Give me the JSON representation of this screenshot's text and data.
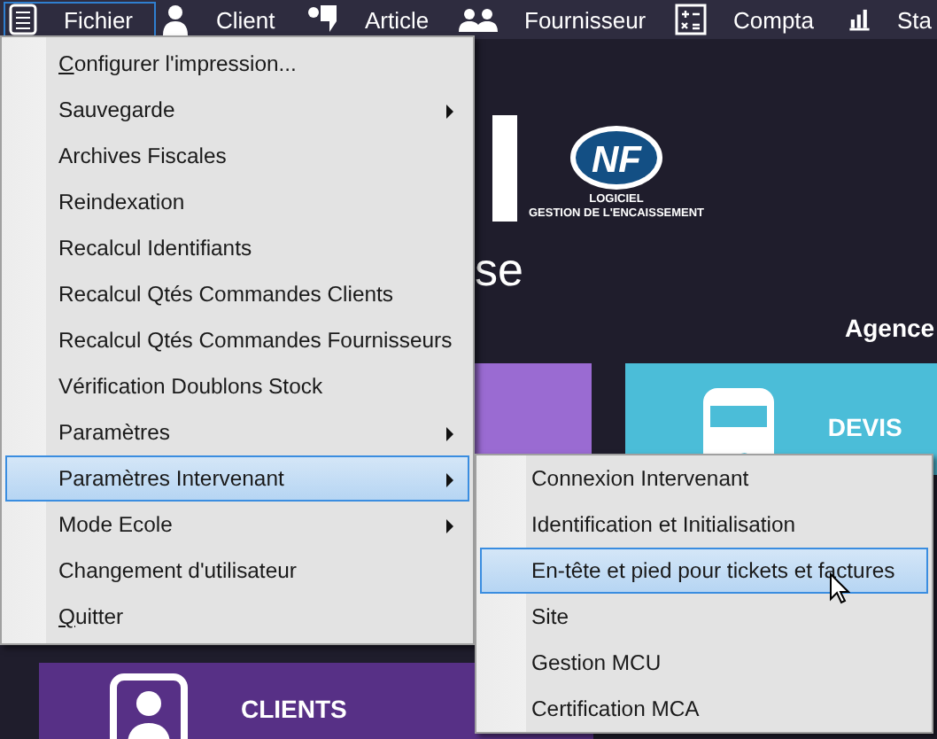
{
  "menubar": {
    "items": [
      {
        "label": "Fichier",
        "selected": true
      },
      {
        "label": "Client",
        "selected": false
      },
      {
        "label": "Article",
        "selected": false
      },
      {
        "label": "Fournisseur",
        "selected": false
      },
      {
        "label": "Compta",
        "selected": false
      },
      {
        "label": "Sta",
        "selected": false
      }
    ]
  },
  "dashboard": {
    "logo": {
      "mark": "NF",
      "caption_1": "LOGICIEL",
      "caption_2": "GESTION DE L'ENCAISSEMENT"
    },
    "title_fragment": "se",
    "agency": "Agence",
    "tiles": [
      {
        "color": "#9a6bd2"
      },
      {
        "label": "DEVIS",
        "color": "#4bbdd8"
      },
      {
        "label": "CLIENTS",
        "color": "#573086"
      }
    ]
  },
  "menu": {
    "items": [
      {
        "label": "Configurer l'impression...",
        "submenu": false,
        "selected": false,
        "mnemonic": true
      },
      {
        "label": "Sauvegarde",
        "submenu": true,
        "selected": false,
        "mnemonic": false
      },
      {
        "label": "Archives Fiscales",
        "submenu": false,
        "selected": false,
        "mnemonic": false
      },
      {
        "label": "Reindexation",
        "submenu": false,
        "selected": false,
        "mnemonic": false
      },
      {
        "label": "Recalcul Identifiants",
        "submenu": false,
        "selected": false,
        "mnemonic": false
      },
      {
        "label": "Recalcul Qtés Commandes Clients",
        "submenu": false,
        "selected": false,
        "mnemonic": false
      },
      {
        "label": "Recalcul Qtés Commandes Fournisseurs",
        "submenu": false,
        "selected": false,
        "mnemonic": false
      },
      {
        "label": "Vérification Doublons Stock",
        "submenu": false,
        "selected": false,
        "mnemonic": false
      },
      {
        "label": "Paramètres",
        "submenu": true,
        "selected": false,
        "mnemonic": false
      },
      {
        "label": "Paramètres Intervenant",
        "submenu": true,
        "selected": true,
        "mnemonic": false
      },
      {
        "label": "Mode Ecole",
        "submenu": true,
        "selected": false,
        "mnemonic": false
      },
      {
        "label": "Changement d'utilisateur",
        "submenu": false,
        "selected": false,
        "mnemonic": false
      },
      {
        "label": "Quitter",
        "submenu": false,
        "selected": false,
        "mnemonic": true
      }
    ]
  },
  "submenu": {
    "items": [
      {
        "label": "Connexion Intervenant",
        "submenu": false,
        "selected": false,
        "mnemonic": false
      },
      {
        "label": "Identification et Initialisation",
        "submenu": false,
        "selected": false,
        "mnemonic": false
      },
      {
        "label": "En-tête et pied pour tickets et factures",
        "submenu": false,
        "selected": true,
        "mnemonic": false
      },
      {
        "label": "Site",
        "submenu": false,
        "selected": false,
        "mnemonic": false
      },
      {
        "label": "Gestion MCU",
        "submenu": false,
        "selected": false,
        "mnemonic": false
      },
      {
        "label": "Certification MCA",
        "submenu": false,
        "selected": false,
        "mnemonic": false
      }
    ]
  }
}
